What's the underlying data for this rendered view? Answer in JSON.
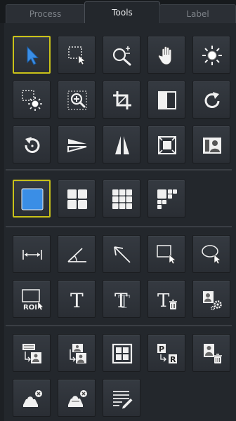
{
  "tabs": [
    {
      "label": "Process",
      "active": false
    },
    {
      "label": "Tools",
      "active": true
    },
    {
      "label": "Label",
      "active": false
    }
  ],
  "colors": {
    "panel": "#23272c",
    "selected_border": "#c9c219",
    "accent_blue": "#3a8ee6",
    "icon_white": "#f2f2f2"
  },
  "tools": {
    "section1": [
      {
        "icon": "pointer-arrow-icon",
        "selected": true
      },
      {
        "icon": "region-select-icon"
      },
      {
        "icon": "zoom-in-out-icon"
      },
      {
        "icon": "pan-hand-icon"
      },
      {
        "icon": "brightness-sun-icon"
      },
      {
        "icon": "region-brightness-icon"
      },
      {
        "icon": "zoom-region-icon"
      },
      {
        "icon": "crop-icon"
      },
      {
        "icon": "invert-contrast-icon"
      },
      {
        "icon": "rotate-clockwise-icon"
      },
      {
        "icon": "rotate-counterclockwise-icon"
      },
      {
        "icon": "flip-vertical-icon"
      },
      {
        "icon": "flip-horizontal-icon"
      },
      {
        "icon": "fit-frame-icon"
      },
      {
        "icon": "portrait-image-icon"
      }
    ],
    "section2": [
      {
        "icon": "layout-1x1-icon",
        "selected": true
      },
      {
        "icon": "layout-2x2-icon"
      },
      {
        "icon": "layout-3x3-icon"
      },
      {
        "icon": "layout-custom-icon"
      }
    ],
    "section3": [
      {
        "icon": "measure-distance-icon"
      },
      {
        "icon": "measure-angle-icon"
      },
      {
        "icon": "arrow-annotation-icon"
      },
      {
        "icon": "rectangle-roi-icon"
      },
      {
        "icon": "ellipse-roi-icon"
      },
      {
        "icon": "roi-tool-icon",
        "text": "ROI"
      },
      {
        "icon": "text-annotation-icon",
        "text": "T"
      },
      {
        "icon": "text-style-icon",
        "text": "T"
      },
      {
        "icon": "text-delete-icon",
        "text": "T"
      },
      {
        "icon": "image-settings-icon"
      }
    ],
    "section4": [
      {
        "icon": "series-sync-icon"
      },
      {
        "icon": "image-stack-sync-icon"
      },
      {
        "icon": "viewport-layout-icon"
      },
      {
        "icon": "swap-pr-icon",
        "text_a": "P",
        "text_b": "R"
      },
      {
        "icon": "delete-image-icon"
      },
      {
        "icon": "clear-annotations-icon"
      },
      {
        "icon": "clear-all-annotations-icon"
      },
      {
        "icon": "annotation-list-icon"
      }
    ]
  }
}
